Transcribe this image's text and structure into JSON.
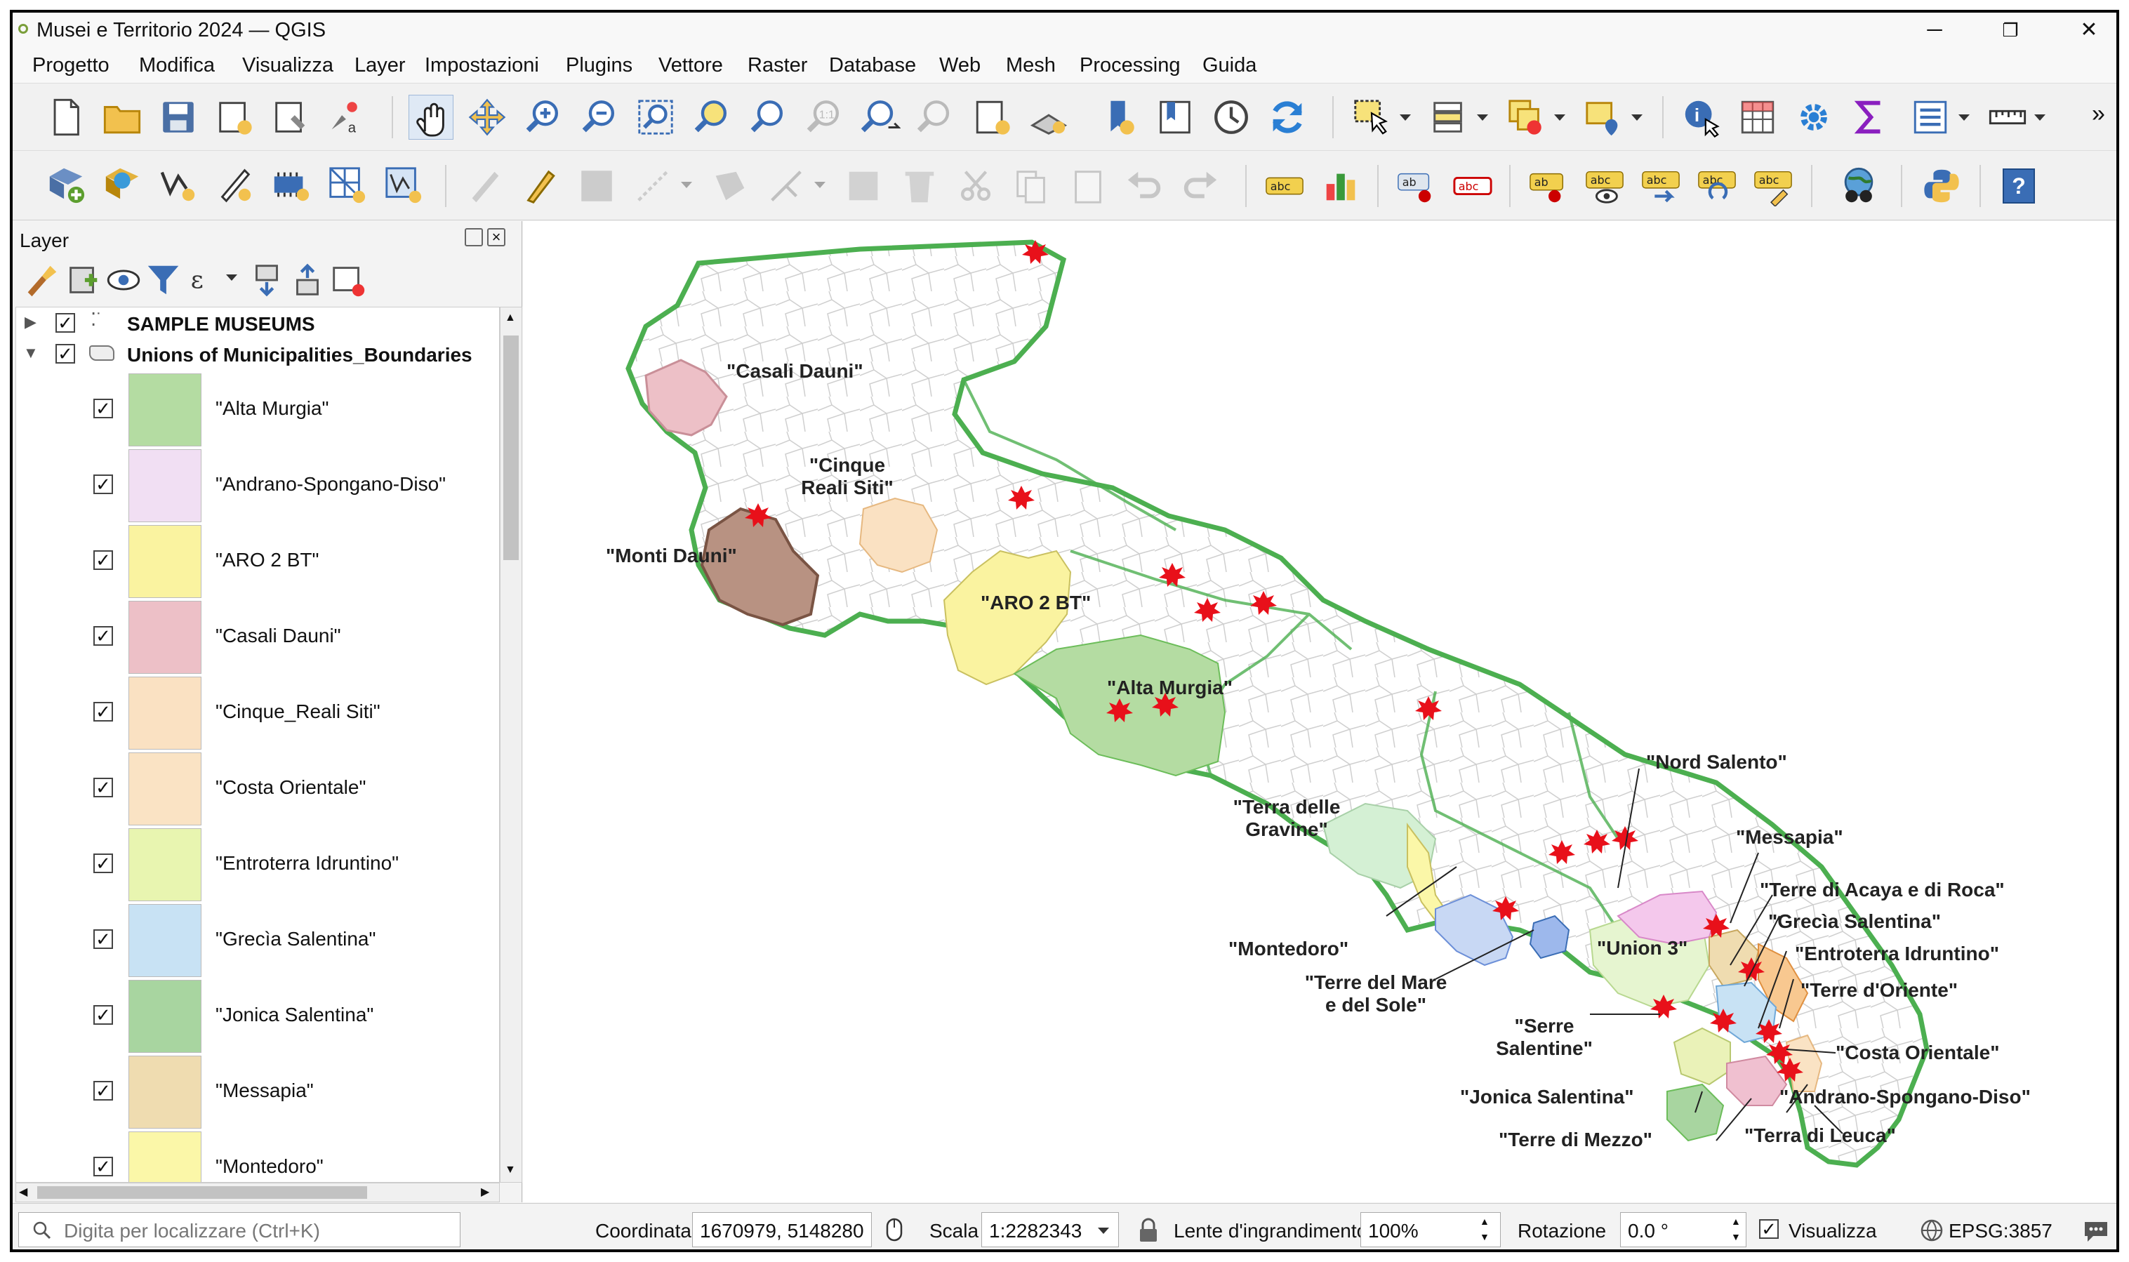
{
  "window": {
    "title": "Musei e Territorio 2024 — QGIS",
    "minimize": "─",
    "restore": "❐",
    "close": "✕"
  },
  "menu": [
    "Progetto",
    "Modifica",
    "Visualizza",
    "Layer",
    "Impostazioni",
    "Plugins",
    "Vettore",
    "Raster",
    "Database",
    "Web",
    "Mesh",
    "Processing",
    "Guida"
  ],
  "toolbar": {
    "overflow": "»",
    "help": "?"
  },
  "layers_panel": {
    "title": "Layer",
    "groups": [
      {
        "label": "SAMPLE MUSEUMS"
      },
      {
        "label": "Unions of Municipalities_Boundaries"
      }
    ],
    "items": [
      {
        "label": "\"Alta Murgia\"",
        "color": "#b4dca2"
      },
      {
        "label": "\"Andrano-Spongano-Diso\"",
        "color": "#f1dff3"
      },
      {
        "label": "\"ARO 2 BT\"",
        "color": "#faf3a0"
      },
      {
        "label": "\"Casali Dauni\"",
        "color": "#edc0c7"
      },
      {
        "label": "\"Cinque_Reali Siti\"",
        "color": "#fae1c2"
      },
      {
        "label": "\"Costa Orientale\"",
        "color": "#fae3c4"
      },
      {
        "label": "\"Entroterra Idruntino\"",
        "color": "#e8f5b0"
      },
      {
        "label": "\"Grecìa Salentina\"",
        "color": "#c8e2f4"
      },
      {
        "label": "\"Jonica Salentina\"",
        "color": "#a8d5a0"
      },
      {
        "label": "\"Messapia\"",
        "color": "#efdcb0"
      },
      {
        "label": "\"Montedoro\"",
        "color": "#fbf7a8"
      }
    ]
  },
  "map": {
    "labels": {
      "casali_dauni": "\"Casali Dauni\"",
      "cinque_l1": "\"Cinque",
      "cinque_l2": "Reali Siti\"",
      "monti_dauni": "\"Monti Dauni\"",
      "aro2bt": "\"ARO 2 BT\"",
      "alta_murgia": "\"Alta Murgia\"",
      "gravine_l1": "\"Terra delle",
      "gravine_l2": "Gravine\"",
      "nord_salento": "\"Nord Salento\"",
      "messapia": "\"Messapia\"",
      "terre_acaya": "\"Terre di Acaya e di Roca\"",
      "grecia": "\"Grecìa Salentina\"",
      "entroterra": "\"Entroterra Idruntino\"",
      "terre_oriente": "\"Terre d'Oriente\"",
      "union3": "\"Union 3\"",
      "montedoro": "\"Montedoro\"",
      "terre_mare_l1": "\"Terre del Mare",
      "terre_mare_l2": "e del Sole\"",
      "serre_l1": "\"Serre",
      "serre_l2": "Salentine\"",
      "costa_orientale": "\"Costa Orientale\"",
      "andrano": "\"Andrano-Spongano-Diso\"",
      "jonica": "\"Jonica Salentina\"",
      "terra_leuca": "\"Terra di Leuca\"",
      "terre_mezzo": "\"Terre di Mezzo\""
    },
    "boundary_color": "#4caf50",
    "museum_marker_color": "#e8101a"
  },
  "statusbar": {
    "locator_placeholder": "Digita per localizzare (Ctrl+K)",
    "coordinate_label": "Coordinata",
    "coordinate_value": "1670979, 5148280",
    "scale_label": "Scala",
    "scale_value": "1:2282343",
    "magnifier_label": "Lente d'ingrandimento",
    "magnifier_value": "100%",
    "rotation_label": "Rotazione",
    "rotation_value": "0.0 °",
    "render_label": "Visualizza",
    "crs": "EPSG:3857"
  }
}
